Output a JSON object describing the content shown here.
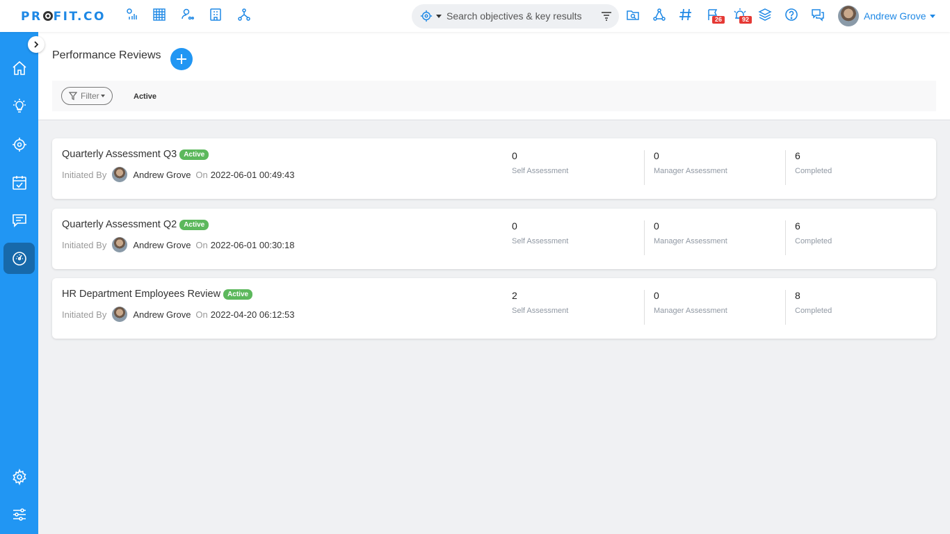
{
  "brand": {
    "logo_pre": "PR",
    "logo_post": "FIT.CO"
  },
  "search": {
    "placeholder": "Search objectives & key results"
  },
  "notifications": {
    "flag_count": "26",
    "alarm_count": "92"
  },
  "user": {
    "name": "Andrew Grove"
  },
  "page": {
    "title": "Performance Reviews"
  },
  "filter": {
    "label": "Filter",
    "active_value": "Active"
  },
  "reviews": [
    {
      "title": "Quarterly Assessment Q3",
      "status": "Active",
      "initiated_label": "Initiated By",
      "initiator": "Andrew Grove",
      "on_label": "On",
      "datetime": "2022-06-01 00:49:43",
      "self": "0",
      "self_label": "Self Assessment",
      "manager": "0",
      "manager_label": "Manager Assessment",
      "completed": "6",
      "completed_label": "Completed"
    },
    {
      "title": "Quarterly Assessment Q2",
      "status": "Active",
      "initiated_label": "Initiated By",
      "initiator": "Andrew Grove",
      "on_label": "On",
      "datetime": "2022-06-01 00:30:18",
      "self": "0",
      "self_label": "Self Assessment",
      "manager": "0",
      "manager_label": "Manager Assessment",
      "completed": "6",
      "completed_label": "Completed"
    },
    {
      "title": "HR Department Employees Review",
      "status": "Active",
      "initiated_label": "Initiated By",
      "initiator": "Andrew Grove",
      "on_label": "On",
      "datetime": "2022-04-20 06:12:53",
      "self": "2",
      "self_label": "Self Assessment",
      "manager": "0",
      "manager_label": "Manager Assessment",
      "completed": "8",
      "completed_label": "Completed"
    }
  ],
  "colors": {
    "primary": "#2196f3",
    "sidebar_active": "#1769aa",
    "status_active": "#5cb85c",
    "badge": "#e53935"
  },
  "icons": {
    "topbar": [
      "chart-icon",
      "grid-icon",
      "people-icon",
      "building-icon",
      "hierarchy-icon",
      "folder-search-icon",
      "network-icon",
      "hashtag-icon",
      "flag-icon",
      "alarm-icon",
      "layers-icon",
      "help-icon",
      "chat-icon"
    ],
    "sidebar": [
      "home-icon",
      "lightbulb-icon",
      "target-icon",
      "calendar-check-icon",
      "feedback-icon",
      "performance-icon",
      "settings-icon",
      "sliders-icon"
    ]
  }
}
